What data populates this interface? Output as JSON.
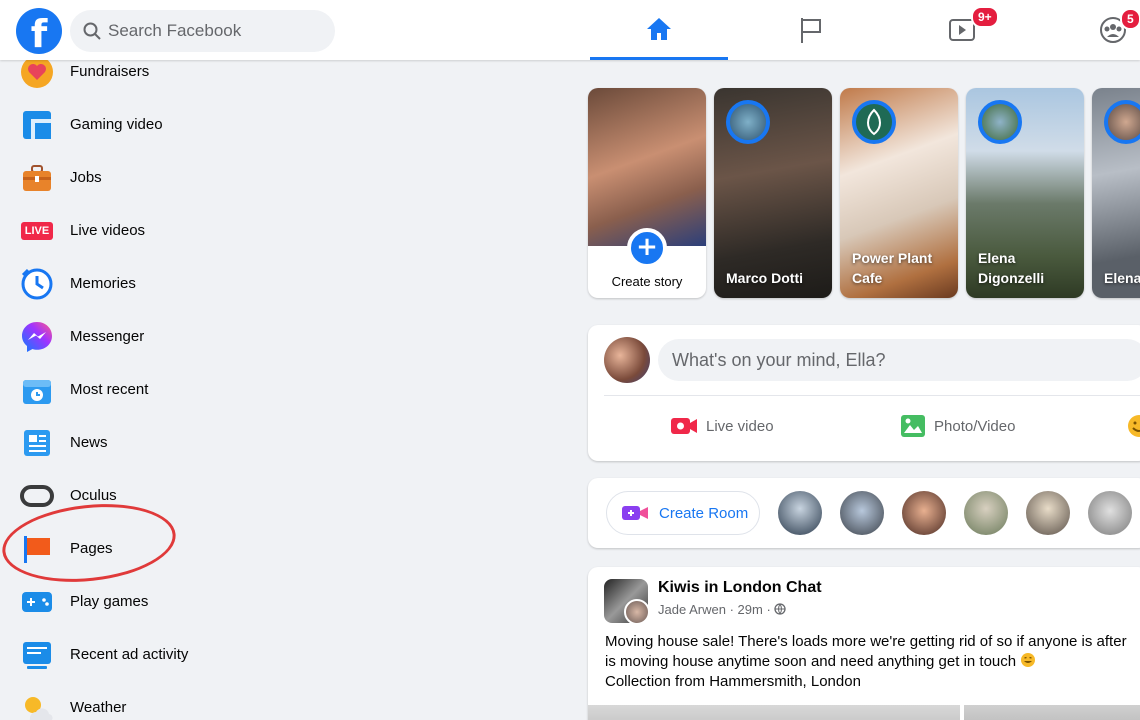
{
  "search": {
    "placeholder": "Search Facebook"
  },
  "nav": {
    "watch_badge": "9+",
    "groups_badge": "5"
  },
  "sidebar": {
    "items": [
      {
        "label": "Fundraisers",
        "icon": "heart-icon"
      },
      {
        "label": "Gaming video",
        "icon": "gaming-video-icon"
      },
      {
        "label": "Jobs",
        "icon": "briefcase-icon"
      },
      {
        "label": "Live videos",
        "icon": "live-icon",
        "icon_text": "LIVE"
      },
      {
        "label": "Memories",
        "icon": "clock-icon"
      },
      {
        "label": "Messenger",
        "icon": "messenger-icon"
      },
      {
        "label": "Most recent",
        "icon": "most-recent-icon"
      },
      {
        "label": "News",
        "icon": "news-icon"
      },
      {
        "label": "Oculus",
        "icon": "oculus-icon"
      },
      {
        "label": "Pages",
        "icon": "flag-icon"
      },
      {
        "label": "Play games",
        "icon": "gamepad-icon"
      },
      {
        "label": "Recent ad activity",
        "icon": "ad-activity-icon"
      },
      {
        "label": "Weather",
        "icon": "weather-icon"
      }
    ]
  },
  "stories": {
    "create_label": "Create story",
    "items": [
      {
        "name": "Marco Dotti"
      },
      {
        "name": "Power Plant Cafe"
      },
      {
        "name": "Elena Digonzelli"
      },
      {
        "name": "Elena Soña"
      }
    ]
  },
  "composer": {
    "placeholder": "What's on your mind, Ella?",
    "live_label": "Live video",
    "photo_label": "Photo/Video"
  },
  "rooms": {
    "create_label": "Create Room"
  },
  "post": {
    "group": "Kiwis in London Chat",
    "author": "Jade Arwen",
    "time": "29m",
    "line1": "Moving house sale! There's loads more we're getting rid of so if anyone is after",
    "line2": "is moving house anytime soon and need anything get in touch",
    "line3": "Collection from Hammersmith, London"
  },
  "colors": {
    "brand": "#1877f2",
    "badge": "#e41e3f",
    "annotation": "#e03a3a"
  }
}
